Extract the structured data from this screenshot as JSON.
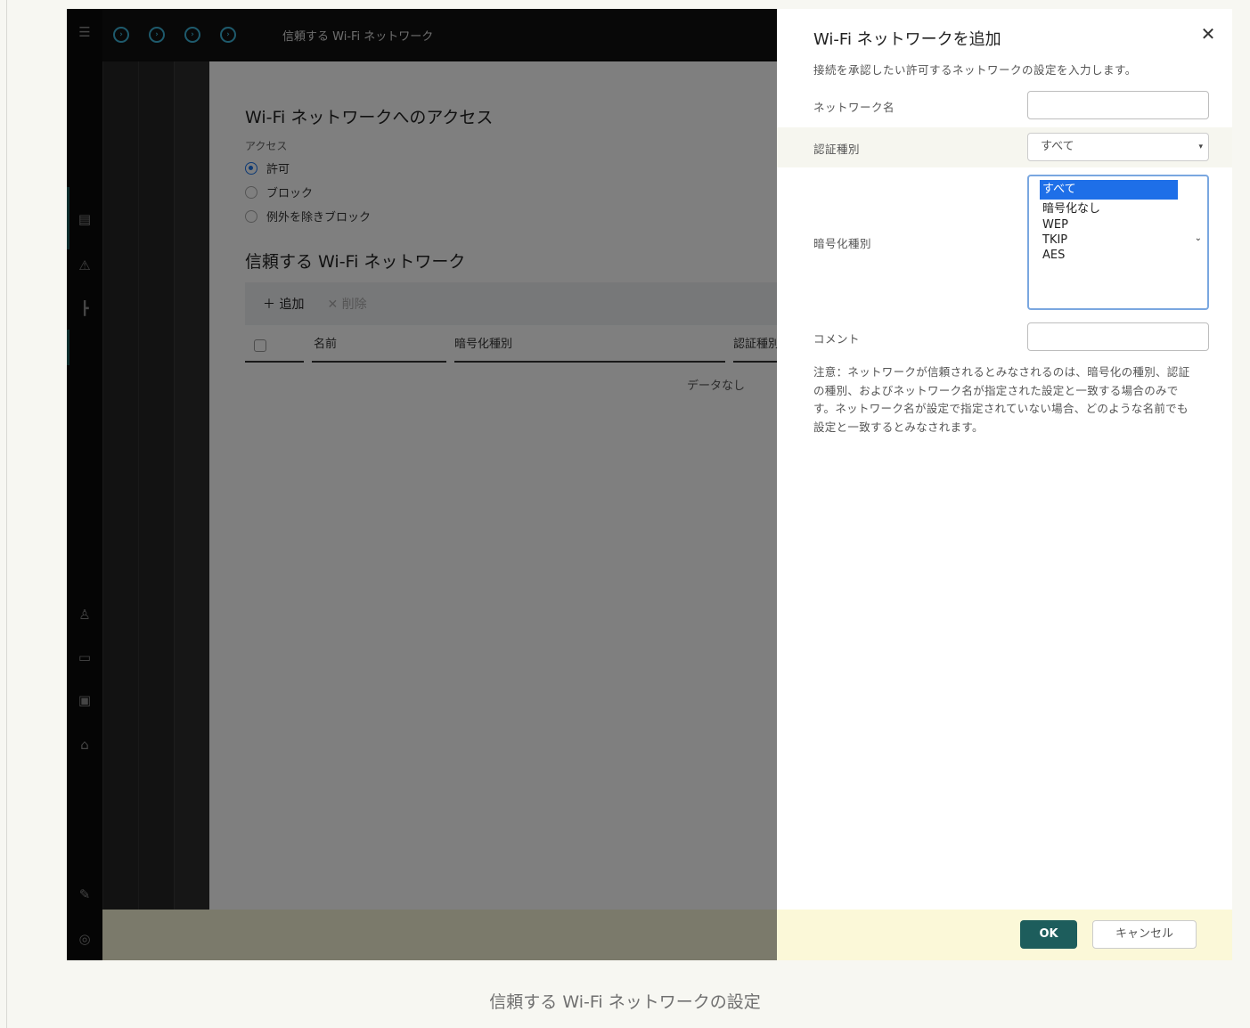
{
  "topbar": {
    "breadcrumb": "信頼する Wi-Fi ネットワーク"
  },
  "page": {
    "section_title": "Wi-Fi ネットワークへのアクセス",
    "access_label": "アクセス",
    "radio_allow": "許可",
    "radio_block": "ブロック",
    "radio_block_except": "例外を除きブロック",
    "list_title": "信頼する Wi-Fi ネットワーク",
    "add_label": "追加",
    "delete_label": "削除",
    "col_name": "名前",
    "col_encryption": "暗号化種別",
    "col_auth": "認証種別",
    "no_data": "データなし"
  },
  "drawer": {
    "title": "Wi-Fi ネットワークを追加",
    "close_icon": "close-icon",
    "subtitle": "接続を承認したい許可するネットワークの設定を入力します。",
    "network_name_label": "ネットワーク名",
    "network_name_value": "",
    "auth_label": "認証種別",
    "auth_value": "すべて",
    "encryption_label": "暗号化種別",
    "encryption_options": [
      "すべて",
      "暗号化なし",
      "WEP",
      "TKIP",
      "AES"
    ],
    "encryption_selected": "すべて",
    "comment_label": "コメント",
    "comment_value": "",
    "note": "注意：ネットワークが信頼されるとみなされるのは、暗号化の種別、認証の種別、およびネットワーク名が指定された設定と一致する場合のみです。ネットワーク名が設定で指定されていない場合、どのような名前でも設定と一致するとみなされます。",
    "ok_label": "OK",
    "cancel_label": "キャンセル"
  },
  "caption": "信頼する Wi-Fi ネットワークの設定",
  "colors": {
    "accent": "#1d5d5c",
    "link": "#3cb4d8",
    "selection": "#1e6fe8"
  }
}
